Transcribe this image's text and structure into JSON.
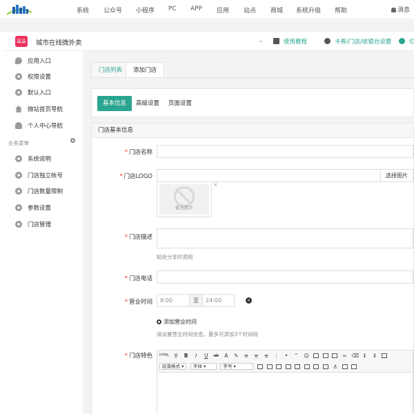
{
  "topnav": {
    "items": [
      "系统",
      "公众号",
      "小程序",
      "PC",
      "APP",
      "应用",
      "站点",
      "商城",
      "系统升级",
      "帮助"
    ],
    "message_label": "消息"
  },
  "header": {
    "app_logo_text": "耳朵",
    "app_title": "城市在线微外卖",
    "tutorial_link": "使用教程",
    "cashier_link": "卡券/门店/收银台设置",
    "extra_link": "切"
  },
  "sidebar": {
    "items": [
      {
        "label": "应用入口",
        "icon": "chat-icon"
      },
      {
        "label": "权限设置",
        "icon": "gear-icon"
      },
      {
        "label": "默认入口",
        "icon": "gear-icon"
      },
      {
        "label": "微站首页导航",
        "icon": "home-icon"
      },
      {
        "label": "个人中心导航",
        "icon": "person-icon"
      }
    ],
    "section_label": "业务菜单",
    "business_items": [
      {
        "label": "系统说明",
        "icon": "gear-icon"
      },
      {
        "label": "门店独立帐号",
        "icon": "gear-icon"
      },
      {
        "label": "门店数量限制",
        "icon": "gear-icon"
      },
      {
        "label": "参数设置",
        "icon": "gear-icon"
      },
      {
        "label": "门店管理",
        "icon": "gear-icon"
      }
    ]
  },
  "main": {
    "tabs": [
      {
        "label": "门店列表",
        "active": false
      },
      {
        "label": "添加门店",
        "active": true
      }
    ],
    "subtabs": [
      {
        "label": "基本信息",
        "active": true
      },
      {
        "label": "高级设置",
        "active": false
      },
      {
        "label": "页面设置",
        "active": false
      }
    ],
    "panel_title": "门店基本信息",
    "form": {
      "name_label": "门店名称",
      "logo_label": "门店LOGO",
      "logo_button": "选择图片",
      "no_image_text": "暂无图片",
      "desc_label": "门店描述",
      "desc_hint": "粘处分享时调用",
      "phone_label": "门店电话",
      "hours_label": "营业时间",
      "hours_start": "8:00",
      "hours_to": "至",
      "hours_end": "24:00",
      "add_hours": "添加营业时间",
      "hours_hint": "请设置营业时间信息。最多可添加3个时间段",
      "feature_label": "门店特色"
    },
    "editor": {
      "html_btn": "HTML",
      "para_format": "段落格式",
      "font_family": "字体",
      "font_size": "字号"
    }
  },
  "colors": {
    "accent": "#2aa58f",
    "required": "#e33333",
    "app_logo": "#e9305c"
  }
}
